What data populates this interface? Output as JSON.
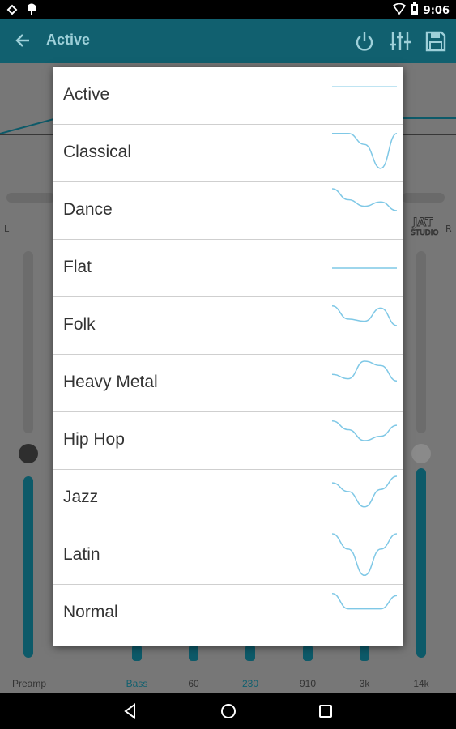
{
  "status_bar": {
    "time": "9:06"
  },
  "app_bar": {
    "title": "Active"
  },
  "channels": {
    "left": "L",
    "right": "R"
  },
  "band_labels": [
    "Preamp",
    "Bass",
    "60",
    "230",
    "910",
    "3k",
    "14k"
  ],
  "presets": [
    {
      "label": "Active",
      "curve": [
        0.3,
        0.3,
        0.3,
        0.3,
        0.3
      ]
    },
    {
      "label": "Classical",
      "curve": [
        0.05,
        0.05,
        0.3,
        0.85,
        0.05
      ]
    },
    {
      "label": "Dance",
      "curve": [
        0.0,
        0.25,
        0.4,
        0.3,
        0.5
      ]
    },
    {
      "label": "Flat",
      "curve": [
        0.5,
        0.5,
        0.5,
        0.5,
        0.5
      ]
    },
    {
      "label": "Folk",
      "curve": [
        0.05,
        0.35,
        0.4,
        0.1,
        0.5
      ]
    },
    {
      "label": "Heavy Metal",
      "curve": [
        0.3,
        0.4,
        0.0,
        0.1,
        0.45
      ]
    },
    {
      "label": "Hip Hop",
      "curve": [
        0.05,
        0.25,
        0.5,
        0.4,
        0.15
      ]
    },
    {
      "label": "Jazz",
      "curve": [
        0.15,
        0.35,
        0.7,
        0.3,
        0.0
      ]
    },
    {
      "label": "Latin",
      "curve": [
        0.0,
        0.35,
        0.95,
        0.35,
        0.0
      ]
    },
    {
      "label": "Normal",
      "curve": [
        0.05,
        0.4,
        0.4,
        0.4,
        0.1
      ]
    }
  ],
  "colors": {
    "accent": "#1f8ea3",
    "curve": "#7fc8e6",
    "app_bar": "#11606f",
    "overlay": "#777777"
  }
}
